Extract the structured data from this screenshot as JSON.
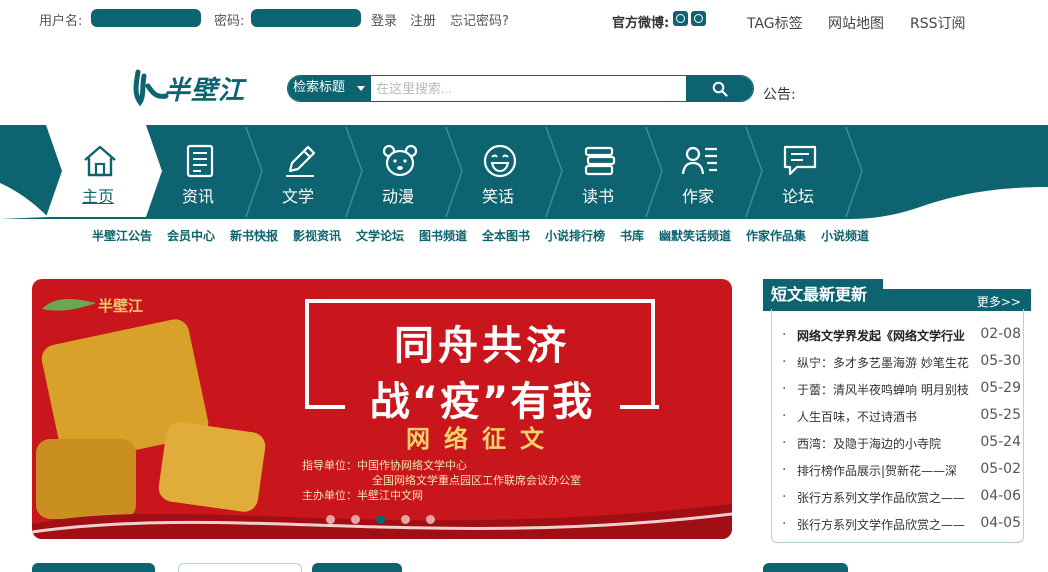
{
  "topbar": {
    "username_label": "用户名:",
    "password_label": "密码:",
    "login": "登录",
    "register": "注册",
    "forgot": "忘记密码?",
    "weibo_label": "官方微博:",
    "links": [
      "TAG标签",
      "网站地图",
      "RSS订阅"
    ]
  },
  "logo": {
    "text": "半壁江"
  },
  "search": {
    "scope": "检索标题",
    "placeholder": "在这里搜索..."
  },
  "notice_label": "公告:",
  "nav": {
    "items": [
      {
        "label": "主页",
        "icon": "home-icon"
      },
      {
        "label": "资讯",
        "icon": "document-icon"
      },
      {
        "label": "文学",
        "icon": "pencil-icon"
      },
      {
        "label": "动漫",
        "icon": "bear-icon"
      },
      {
        "label": "笑话",
        "icon": "smile-icon"
      },
      {
        "label": "读书",
        "icon": "books-icon"
      },
      {
        "label": "作家",
        "icon": "user-list-icon"
      },
      {
        "label": "论坛",
        "icon": "chat-icon"
      }
    ]
  },
  "subnav": [
    "半壁江公告",
    "会员中心",
    "新书快报",
    "影视资讯",
    "文学论坛",
    "图书频道",
    "全本图书",
    "小说排行榜",
    "书库",
    "幽默笑话频道",
    "作家作品集",
    "小说频道"
  ],
  "banner": {
    "logo_text": "半壁江",
    "title_line1": "同舟共济",
    "title_line2": "战“疫”有我",
    "subtitle": "网络征文",
    "org1": "指导单位：中国作协网络文学中心",
    "org2": "全国网络文学重点园区工作联席会议办公室",
    "org3": "主办单位：半壁江中文网",
    "slides": 5,
    "active_slide": 3
  },
  "panel": {
    "title": "短文最新更新",
    "more": "更多>>",
    "items": [
      {
        "title": "网络文学界发起《网络文学行业",
        "date": "02-08"
      },
      {
        "title": "纵宁：多才多艺墨海游 妙笔生花",
        "date": "05-30"
      },
      {
        "title": "于蕾：清风半夜鸣蝉响 明月别枝",
        "date": "05-29"
      },
      {
        "title": "人生百味，不过诗酒书",
        "date": "05-25"
      },
      {
        "title": "西湾：及隐于海边的小寺院",
        "date": "05-24"
      },
      {
        "title": "排行榜作品展示|贺新花——深",
        "date": "05-02"
      },
      {
        "title": "张行方系列文学作品欣赏之——",
        "date": "04-06"
      },
      {
        "title": "张行方系列文学作品欣赏之——",
        "date": "04-05"
      }
    ]
  },
  "colors": {
    "brand": "#0d6470",
    "banner_red": "#c9151c",
    "gold": "#d8a12a"
  }
}
